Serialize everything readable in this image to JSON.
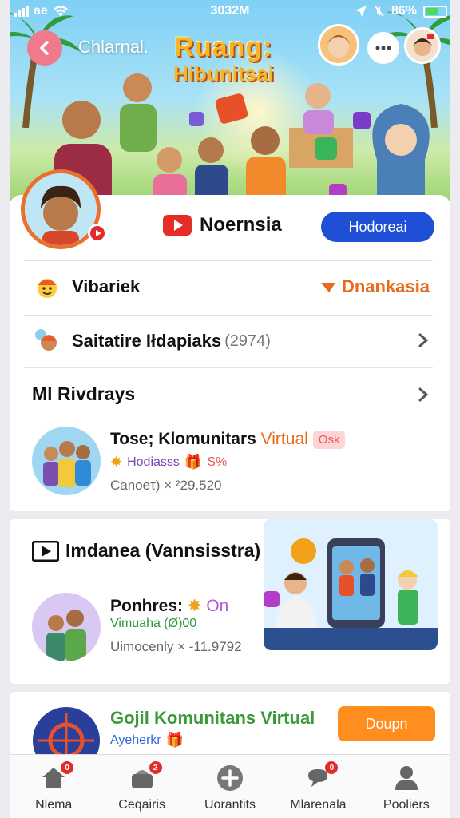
{
  "status_bar": {
    "carrier": "ae",
    "time": "3032M",
    "battery": "86%"
  },
  "header": {
    "channel_label": "Chlarnal.",
    "banner_title_line1": "Ruang:",
    "banner_title_line2": "Hibunitsai"
  },
  "profile": {
    "platform_name": "Noernsia",
    "subscribe_label": "Hodoreai"
  },
  "rows": {
    "row1_label": "Vibariek",
    "row1_tag": "Dnankasia",
    "row2_label": "Saitatire Iłdapiaks",
    "row2_count": "(2974)"
  },
  "section1": {
    "title": "Ml Rivdrays",
    "item": {
      "title": "Tose; Klomunitars",
      "title_accent": "Virtual",
      "pill": "Osk",
      "sub_label": "Hodiasss",
      "sub_pct": "S%",
      "meta": "Canoeτ) × ²29.520"
    }
  },
  "section2": {
    "title": "Imdanea (Vannsisstra)",
    "item": {
      "title": "Ponhres:",
      "title_accent": "On",
      "sub_label": "Vimuaha (Ø)00",
      "meta": "Uimocenly × -11.9792"
    }
  },
  "section3": {
    "title": "Gojil Komunitans Virtual",
    "sub_label": "Ayeherkr",
    "join_label": "Doupn"
  },
  "nav": [
    {
      "label": "Nlema",
      "badge": "0"
    },
    {
      "label": "Ceqairis",
      "badge": "2"
    },
    {
      "label": "Uorantits",
      "badge": ""
    },
    {
      "label": "Mlarenala",
      "badge": "0"
    },
    {
      "label": "Pooliers",
      "badge": ""
    }
  ],
  "colors": {
    "accent_blue": "#1e4fd6",
    "accent_orange": "#e86a1a",
    "live_red": "#e32b2b",
    "join_orange": "#ff8e1f"
  }
}
